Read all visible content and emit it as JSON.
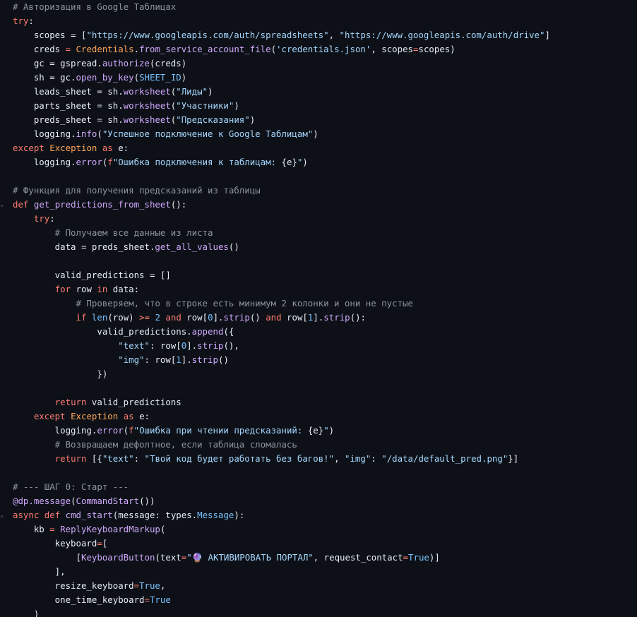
{
  "colors": {
    "background": "#0d1117",
    "default": "#e6edf3",
    "comment": "#8b949e",
    "keyword": "#ff7b72",
    "string": "#a5d6ff",
    "function": "#d2a8ff",
    "constant": "#79c0ff",
    "class": "#ffa657"
  },
  "gutter": {
    "marker_glyph": "⌄",
    "marker_lines": [
      14,
      36
    ]
  },
  "code": [
    [
      [
        "c",
        "# Авторизация в Google Таблицах"
      ]
    ],
    [
      [
        "k",
        "try"
      ],
      [
        "d",
        ":"
      ]
    ],
    [
      [
        "d",
        "    scopes = ["
      ],
      [
        "s",
        "\"https://www.googleapis.com/auth/spreadsheets\""
      ],
      [
        "d",
        ", "
      ],
      [
        "s",
        "\"https://www.googleapis.com/auth/drive\""
      ],
      [
        "d",
        "]"
      ]
    ],
    [
      [
        "d",
        "    creds "
      ],
      [
        "k",
        "="
      ],
      [
        "d",
        " "
      ],
      [
        "o",
        "Credentials"
      ],
      [
        "d",
        "."
      ],
      [
        "f",
        "from_service_account_file"
      ],
      [
        "d",
        "("
      ],
      [
        "s",
        "'credentials.json'"
      ],
      [
        "d",
        ", scopes"
      ],
      [
        "k",
        "="
      ],
      [
        "d",
        "scopes)"
      ]
    ],
    [
      [
        "d",
        "    gc = gspread."
      ],
      [
        "f",
        "authorize"
      ],
      [
        "d",
        "(creds)"
      ]
    ],
    [
      [
        "d",
        "    sh = gc."
      ],
      [
        "f",
        "open_by_key"
      ],
      [
        "d",
        "("
      ],
      [
        "n",
        "SHEET_ID"
      ],
      [
        "d",
        ")"
      ]
    ],
    [
      [
        "d",
        "    leads_sheet = sh."
      ],
      [
        "f",
        "worksheet"
      ],
      [
        "d",
        "("
      ],
      [
        "s",
        "\"Лиды\""
      ],
      [
        "d",
        ")"
      ]
    ],
    [
      [
        "d",
        "    parts_sheet = sh."
      ],
      [
        "f",
        "worksheet"
      ],
      [
        "d",
        "("
      ],
      [
        "s",
        "\"Участники\""
      ],
      [
        "d",
        ")"
      ]
    ],
    [
      [
        "d",
        "    preds_sheet = sh."
      ],
      [
        "f",
        "worksheet"
      ],
      [
        "d",
        "("
      ],
      [
        "s",
        "\"Предсказания\""
      ],
      [
        "d",
        ")"
      ]
    ],
    [
      [
        "d",
        "    logging."
      ],
      [
        "f",
        "info"
      ],
      [
        "d",
        "("
      ],
      [
        "s",
        "\"Успешное подключение к Google Таблицам\""
      ],
      [
        "d",
        ")"
      ]
    ],
    [
      [
        "k",
        "except"
      ],
      [
        "d",
        " "
      ],
      [
        "o",
        "Exception"
      ],
      [
        "d",
        " "
      ],
      [
        "k",
        "as"
      ],
      [
        "d",
        " e:"
      ]
    ],
    [
      [
        "d",
        "    logging."
      ],
      [
        "f",
        "error"
      ],
      [
        "d",
        "("
      ],
      [
        "k",
        "f"
      ],
      [
        "s",
        "\"Ошибка подключения к таблицам: "
      ],
      [
        "d",
        "{e}"
      ],
      [
        "s",
        "\""
      ],
      [
        "d",
        ")"
      ]
    ],
    [],
    [
      [
        "c",
        "# Функция для получения предсказаний из таблицы"
      ]
    ],
    [
      [
        "k",
        "def"
      ],
      [
        "d",
        " "
      ],
      [
        "f",
        "get_predictions_from_sheet"
      ],
      [
        "d",
        "():"
      ]
    ],
    [
      [
        "d",
        "    "
      ],
      [
        "k",
        "try"
      ],
      [
        "d",
        ":"
      ]
    ],
    [
      [
        "c",
        "        # Получаем все данные из листа"
      ]
    ],
    [
      [
        "d",
        "        data = preds_sheet."
      ],
      [
        "f",
        "get_all_values"
      ],
      [
        "d",
        "()"
      ]
    ],
    [],
    [
      [
        "d",
        "        valid_predictions = []"
      ]
    ],
    [
      [
        "d",
        "        "
      ],
      [
        "k",
        "for"
      ],
      [
        "d",
        " row "
      ],
      [
        "k",
        "in"
      ],
      [
        "d",
        " data:"
      ]
    ],
    [
      [
        "c",
        "            # Проверяем, что в строке есть минимум 2 колонки и они не пустые"
      ]
    ],
    [
      [
        "d",
        "            "
      ],
      [
        "k",
        "if"
      ],
      [
        "d",
        " "
      ],
      [
        "n",
        "len"
      ],
      [
        "d",
        "(row) "
      ],
      [
        "k",
        ">="
      ],
      [
        "d",
        " "
      ],
      [
        "n",
        "2"
      ],
      [
        "d",
        " "
      ],
      [
        "k",
        "and"
      ],
      [
        "d",
        " row["
      ],
      [
        "n",
        "0"
      ],
      [
        "d",
        "]."
      ],
      [
        "f",
        "strip"
      ],
      [
        "d",
        "() "
      ],
      [
        "k",
        "and"
      ],
      [
        "d",
        " row["
      ],
      [
        "n",
        "1"
      ],
      [
        "d",
        "]."
      ],
      [
        "f",
        "strip"
      ],
      [
        "d",
        "():"
      ]
    ],
    [
      [
        "d",
        "                valid_predictions."
      ],
      [
        "f",
        "append"
      ],
      [
        "d",
        "({"
      ]
    ],
    [
      [
        "d",
        "                    "
      ],
      [
        "s",
        "\"text\""
      ],
      [
        "d",
        ": row["
      ],
      [
        "n",
        "0"
      ],
      [
        "d",
        "]."
      ],
      [
        "f",
        "strip"
      ],
      [
        "d",
        "(),"
      ]
    ],
    [
      [
        "d",
        "                    "
      ],
      [
        "s",
        "\"img\""
      ],
      [
        "d",
        ": row["
      ],
      [
        "n",
        "1"
      ],
      [
        "d",
        "]."
      ],
      [
        "f",
        "strip"
      ],
      [
        "d",
        "()"
      ]
    ],
    [
      [
        "d",
        "                })"
      ]
    ],
    [],
    [
      [
        "d",
        "        "
      ],
      [
        "k",
        "return"
      ],
      [
        "d",
        " valid_predictions"
      ]
    ],
    [
      [
        "d",
        "    "
      ],
      [
        "k",
        "except"
      ],
      [
        "d",
        " "
      ],
      [
        "o",
        "Exception"
      ],
      [
        "d",
        " "
      ],
      [
        "k",
        "as"
      ],
      [
        "d",
        " e:"
      ]
    ],
    [
      [
        "d",
        "        logging."
      ],
      [
        "f",
        "error"
      ],
      [
        "d",
        "("
      ],
      [
        "k",
        "f"
      ],
      [
        "s",
        "\"Ошибка при чтении предсказаний: "
      ],
      [
        "d",
        "{e}"
      ],
      [
        "s",
        "\""
      ],
      [
        "d",
        ")"
      ]
    ],
    [
      [
        "c",
        "        # Возвращаем дефолтное, если таблица сломалась"
      ]
    ],
    [
      [
        "d",
        "        "
      ],
      [
        "k",
        "return"
      ],
      [
        "d",
        " [{"
      ],
      [
        "s",
        "\"text\""
      ],
      [
        "d",
        ": "
      ],
      [
        "s",
        "\"Твой код будет работать без багов!\""
      ],
      [
        "d",
        ", "
      ],
      [
        "s",
        "\"img\""
      ],
      [
        "d",
        ": "
      ],
      [
        "s",
        "\"/data/default_pred.png\""
      ],
      [
        "d",
        "}]"
      ]
    ],
    [],
    [
      [
        "c",
        "# --- ШАГ 0: Старт ---"
      ]
    ],
    [
      [
        "f",
        "@dp.message"
      ],
      [
        "d",
        "("
      ],
      [
        "f",
        "CommandStart"
      ],
      [
        "d",
        "())"
      ]
    ],
    [
      [
        "k",
        "async"
      ],
      [
        "d",
        " "
      ],
      [
        "k",
        "def"
      ],
      [
        "d",
        " "
      ],
      [
        "f",
        "cmd_start"
      ],
      [
        "d",
        "(message: types."
      ],
      [
        "n",
        "Message"
      ],
      [
        "d",
        "):"
      ]
    ],
    [
      [
        "d",
        "    kb "
      ],
      [
        "k",
        "="
      ],
      [
        "d",
        " "
      ],
      [
        "f",
        "ReplyKeyboardMarkup"
      ],
      [
        "d",
        "("
      ]
    ],
    [
      [
        "d",
        "        keyboard"
      ],
      [
        "k",
        "="
      ],
      [
        "d",
        "["
      ]
    ],
    [
      [
        "d",
        "            ["
      ],
      [
        "f",
        "KeyboardButton"
      ],
      [
        "d",
        "(text"
      ],
      [
        "k",
        "="
      ],
      [
        "s",
        "\"🔮 АКТИВИРОВАТЬ ПОРТАЛ\""
      ],
      [
        "d",
        ", request_contact"
      ],
      [
        "k",
        "="
      ],
      [
        "n",
        "True"
      ],
      [
        "d",
        ")]"
      ]
    ],
    [
      [
        "d",
        "        ],"
      ]
    ],
    [
      [
        "d",
        "        resize_keyboard"
      ],
      [
        "k",
        "="
      ],
      [
        "n",
        "True"
      ],
      [
        "d",
        ","
      ]
    ],
    [
      [
        "d",
        "        one_time_keyboard"
      ],
      [
        "k",
        "="
      ],
      [
        "n",
        "True"
      ]
    ],
    [
      [
        "d",
        "    )"
      ]
    ]
  ]
}
